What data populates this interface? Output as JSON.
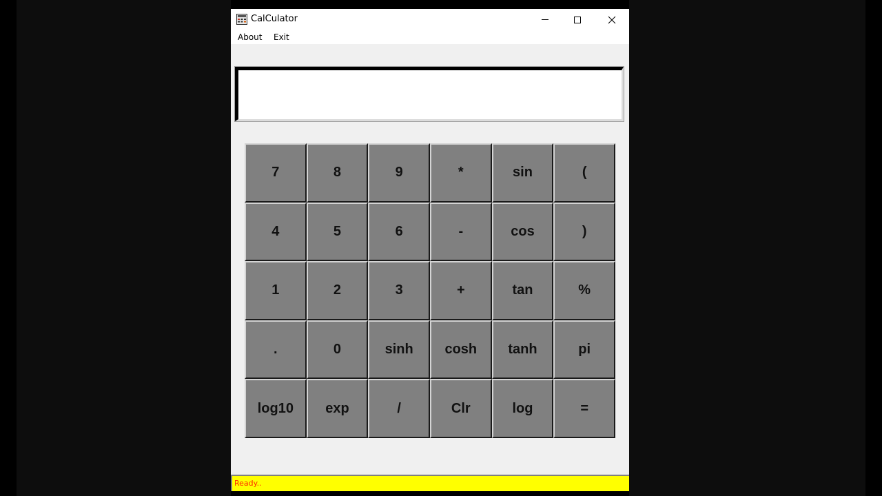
{
  "window": {
    "title": "CalCulator",
    "icon": "calculator-icon"
  },
  "menubar": {
    "items": [
      "About",
      "Exit"
    ]
  },
  "display": {
    "value": ""
  },
  "keypad": {
    "keys": [
      "7",
      "8",
      "9",
      "*",
      "sin",
      "(",
      "4",
      "5",
      "6",
      "-",
      "cos",
      ")",
      "1",
      "2",
      "3",
      "+",
      "tan",
      "%",
      ".",
      "0",
      "sinh",
      "cosh",
      "tanh",
      "pi",
      "log10",
      "exp",
      "/",
      "Clr",
      "log",
      "="
    ]
  },
  "status": {
    "text": "Ready.."
  },
  "colors": {
    "key_face": "#808080",
    "statusbar": "#ffff00",
    "status_text": "#ff2a00"
  }
}
